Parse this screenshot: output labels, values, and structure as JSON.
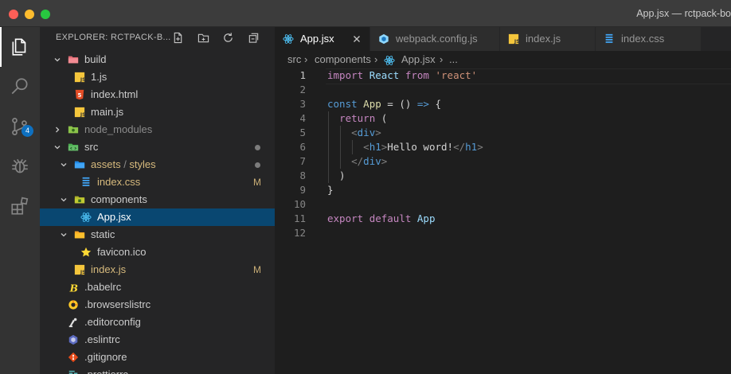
{
  "window": {
    "title": "App.jsx — rctpack-bo"
  },
  "activity_bar": {
    "items": [
      {
        "icon": "files-icon",
        "active": true
      },
      {
        "icon": "search-icon",
        "active": false
      },
      {
        "icon": "source-control-icon",
        "active": false,
        "badge": "4"
      },
      {
        "icon": "debug-icon",
        "active": false
      },
      {
        "icon": "extensions-icon",
        "active": false
      }
    ]
  },
  "explorer": {
    "title": "EXPLORER: RCTPACK-B...",
    "actions": [
      "new-file-icon",
      "new-folder-icon",
      "refresh-icon",
      "collapse-all-icon"
    ],
    "tree": [
      {
        "label": "build",
        "type": "folder-open",
        "depth": 0,
        "icon_color": "#e06c75"
      },
      {
        "label": "1.js",
        "type": "js",
        "depth": 1
      },
      {
        "label": "index.html",
        "type": "html",
        "depth": 1
      },
      {
        "label": "main.js",
        "type": "js",
        "depth": 1
      },
      {
        "label": "node_modules",
        "type": "folder-closed",
        "depth": 0,
        "icon_color": "#8bc34a"
      },
      {
        "label": "src",
        "type": "folder-open",
        "depth": 0,
        "icon_color": "#4caf50",
        "dot": true
      },
      {
        "label_main": "assets",
        "label_sep": " / ",
        "label_sub": "styles",
        "type": "folder-open",
        "depth": 1,
        "icon_color": "#42a5f5",
        "dot": true
      },
      {
        "label": "index.css",
        "type": "css",
        "depth": 2,
        "modified": "M",
        "label_color": "yellow"
      },
      {
        "label": "components",
        "type": "folder-open",
        "depth": 1,
        "icon_color": "#c0ca33"
      },
      {
        "label": "App.jsx",
        "type": "react",
        "depth": 2,
        "selected": true
      },
      {
        "label": "static",
        "type": "folder-open",
        "depth": 1,
        "icon_color": "#fbc02d"
      },
      {
        "label": "favicon.ico",
        "type": "star",
        "depth": 2
      },
      {
        "label": "index.js",
        "type": "js",
        "depth": 1,
        "modified": "M",
        "label_color": "yellow"
      },
      {
        "label": ".babelrc",
        "type": "babel",
        "depth": 0
      },
      {
        "label": ".browserslistrc",
        "type": "browserslist",
        "depth": 0
      },
      {
        "label": ".editorconfig",
        "type": "editorconfig",
        "depth": 0
      },
      {
        "label": ".eslintrc",
        "type": "eslint",
        "depth": 0
      },
      {
        "label": ".gitignore",
        "type": "git",
        "depth": 0
      },
      {
        "label": ".prettierrc",
        "type": "prettier",
        "depth": 0
      }
    ]
  },
  "tabs": [
    {
      "label": "App.jsx",
      "icon": "react-icon",
      "active": true,
      "closable": true
    },
    {
      "label": "webpack.config.js",
      "icon": "webpack-icon",
      "active": false
    },
    {
      "label": "index.js",
      "icon": "js-icon",
      "active": false
    },
    {
      "label": "index.css",
      "icon": "css-icon",
      "active": false
    }
  ],
  "breadcrumb": {
    "seg1": "src",
    "seg2": "components",
    "seg3": "App.jsx",
    "seg4": "..."
  },
  "code": {
    "cursor_line": 1,
    "lines": [
      {
        "n": "1",
        "t": [
          [
            "kw",
            "import"
          ],
          [
            "pl",
            " "
          ],
          [
            "id",
            "React"
          ],
          [
            "pl",
            " "
          ],
          [
            "kw",
            "from"
          ],
          [
            "pl",
            " "
          ],
          [
            "str",
            "'react'"
          ]
        ]
      },
      {
        "n": "2",
        "t": []
      },
      {
        "n": "3",
        "t": [
          [
            "kb",
            "const"
          ],
          [
            "pl",
            " "
          ],
          [
            "fn",
            "App"
          ],
          [
            "pl",
            " = () "
          ],
          [
            "kb",
            "=>"
          ],
          [
            "pl",
            " {"
          ]
        ]
      },
      {
        "n": "4",
        "t": [
          [
            "pl",
            "  "
          ],
          [
            "kw",
            "return"
          ],
          [
            "pl",
            " ("
          ]
        ],
        "guides": [
          1
        ]
      },
      {
        "n": "5",
        "t": [
          [
            "pl",
            "    "
          ],
          [
            "br",
            "<"
          ],
          [
            "tg",
            "div"
          ],
          [
            "br",
            ">"
          ]
        ],
        "guides": [
          1,
          2
        ]
      },
      {
        "n": "6",
        "t": [
          [
            "pl",
            "      "
          ],
          [
            "br",
            "<"
          ],
          [
            "tg",
            "h1"
          ],
          [
            "br",
            ">"
          ],
          [
            "pl",
            "Hello word!"
          ],
          [
            "br",
            "</"
          ],
          [
            "tg",
            "h1"
          ],
          [
            "br",
            ">"
          ]
        ],
        "guides": [
          1,
          2,
          3
        ]
      },
      {
        "n": "7",
        "t": [
          [
            "pl",
            "    "
          ],
          [
            "br",
            "</"
          ],
          [
            "tg",
            "div"
          ],
          [
            "br",
            ">"
          ]
        ],
        "guides": [
          1,
          2
        ]
      },
      {
        "n": "8",
        "t": [
          [
            "pl",
            "  )"
          ]
        ],
        "guides": [
          1
        ]
      },
      {
        "n": "9",
        "t": [
          [
            "pl",
            "}"
          ]
        ]
      },
      {
        "n": "10",
        "t": []
      },
      {
        "n": "11",
        "t": [
          [
            "kw",
            "export"
          ],
          [
            "pl",
            " "
          ],
          [
            "kw",
            "default"
          ],
          [
            "pl",
            " "
          ],
          [
            "id",
            "App"
          ]
        ]
      },
      {
        "n": "12",
        "t": []
      }
    ]
  }
}
